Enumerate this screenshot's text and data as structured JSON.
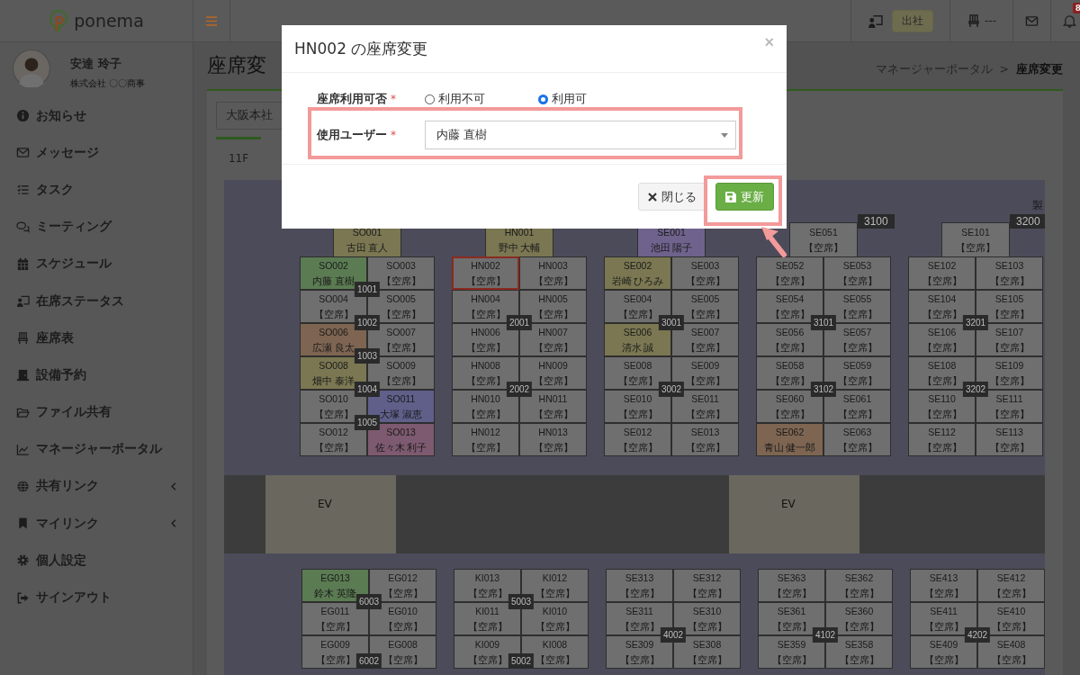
{
  "topbar": {
    "logo": "ponema",
    "status": "出社",
    "seat": "---",
    "notifications": "8"
  },
  "sidebar": {
    "user": {
      "name": "安達 玲子",
      "company": "株式会社 〇〇商事"
    },
    "items": [
      {
        "label": "お知らせ",
        "kind": "link"
      },
      {
        "label": "メッセージ",
        "kind": "link"
      },
      {
        "label": "タスク",
        "kind": "link"
      },
      {
        "label": "ミーティング",
        "kind": "link"
      },
      {
        "label": "スケジュール",
        "kind": "link"
      },
      {
        "label": "在席ステータス",
        "kind": "link"
      },
      {
        "label": "座席表",
        "kind": "link"
      },
      {
        "label": "設備予約",
        "kind": "link"
      },
      {
        "label": "ファイル共有",
        "kind": "link"
      },
      {
        "label": "マネージャーポータル",
        "kind": "link"
      },
      {
        "label": "共有リンク",
        "kind": "group"
      },
      {
        "label": "マイリンク",
        "kind": "group"
      },
      {
        "label": "個人設定",
        "kind": "link"
      },
      {
        "label": "サインアウト",
        "kind": "link"
      }
    ]
  },
  "page": {
    "title": "座席変",
    "breadcrumb": [
      {
        "label": "マネージャーポータル",
        "kind": "link"
      },
      {
        "label": ">",
        "kind": "separator"
      },
      {
        "label": "座席変更",
        "kind": "current"
      }
    ],
    "office": "大阪本社",
    "tabs": [
      {
        "label": "11F",
        "selected": true
      }
    ]
  },
  "seat_map": {
    "corner_label": "製",
    "top_blocks": [
      {
        "head": {
          "id": "SO001",
          "user": "古田 直人",
          "color": "#7a7752",
          "selected": false
        },
        "rows": [
          {
            "seats": [
              {
                "id": "SO002",
                "user": "内藤 直樹",
                "color": "#5b7b52",
                "selected": false
              },
              {
                "id": "SO003",
                "user": "【空席】",
                "selected": false
              }
            ],
            "desk_label": "1001"
          },
          {
            "seats": [
              {
                "id": "SO004",
                "user": "【空席】",
                "selected": false
              },
              {
                "id": "SO005",
                "user": "【空席】",
                "selected": false
              }
            ],
            "desk_label": "1002"
          },
          {
            "seats": [
              {
                "id": "SO006",
                "user": "広瀬 良太",
                "color": "#7d6552",
                "selected": false
              },
              {
                "id": "SO007",
                "user": "【空席】",
                "selected": false
              }
            ],
            "desk_label": "1003"
          },
          {
            "seats": [
              {
                "id": "SO008",
                "user": "畑中 泰洋",
                "color": "#7a7752",
                "selected": false
              },
              {
                "id": "SO009",
                "user": "【空席】",
                "selected": false
              }
            ],
            "desk_label": "1004"
          },
          {
            "seats": [
              {
                "id": "SO010",
                "user": "【空席】",
                "selected": false
              },
              {
                "id": "SO011",
                "user": "大塚 淑恵",
                "color": "#5f5f8a",
                "selected": false
              }
            ],
            "desk_label": "1005"
          },
          {
            "seats": [
              {
                "id": "SO012",
                "user": "【空席】",
                "selected": false
              },
              {
                "id": "SO013",
                "user": "佐々木 利子",
                "color": "#7d5a70",
                "selected": false
              }
            ]
          }
        ]
      },
      {
        "head": {
          "id": "HN001",
          "user": "野中 大輔",
          "color": "#7a7752",
          "selected": false
        },
        "rows": [
          {
            "seats": [
              {
                "id": "HN002",
                "user": "【空席】",
                "selected": true
              },
              {
                "id": "HN003",
                "user": "【空席】",
                "selected": false
              }
            ]
          },
          {
            "seats": [
              {
                "id": "HN004",
                "user": "【空席】",
                "selected": false
              },
              {
                "id": "HN005",
                "user": "【空席】",
                "selected": false
              }
            ],
            "desk_label": "2001"
          },
          {
            "seats": [
              {
                "id": "HN006",
                "user": "【空席】",
                "selected": false
              },
              {
                "id": "HN007",
                "user": "【空席】",
                "selected": false
              }
            ]
          },
          {
            "seats": [
              {
                "id": "HN008",
                "user": "【空席】",
                "selected": false
              },
              {
                "id": "HN009",
                "user": "【空席】",
                "selected": false
              }
            ],
            "desk_label": "2002"
          },
          {
            "seats": [
              {
                "id": "HN010",
                "user": "【空席】",
                "selected": false
              },
              {
                "id": "HN011",
                "user": "【空席】",
                "selected": false
              }
            ]
          },
          {
            "seats": [
              {
                "id": "HN012",
                "user": "【空席】",
                "selected": false
              },
              {
                "id": "HN013",
                "user": "【空席】",
                "selected": false
              }
            ]
          }
        ]
      },
      {
        "head": {
          "id": "SE001",
          "user": "池田 陽子",
          "color": "#6f628c",
          "selected": false
        },
        "rows": [
          {
            "seats": [
              {
                "id": "SE002",
                "user": "岩崎 ひろみ",
                "color": "#7a7752",
                "selected": false
              },
              {
                "id": "SE003",
                "user": "【空席】",
                "selected": false
              }
            ]
          },
          {
            "seats": [
              {
                "id": "SE004",
                "user": "【空席】",
                "selected": false
              },
              {
                "id": "SE005",
                "user": "【空席】",
                "selected": false
              }
            ],
            "desk_label": "3001"
          },
          {
            "seats": [
              {
                "id": "SE006",
                "user": "清水 誠",
                "color": "#7a7752",
                "selected": false
              },
              {
                "id": "SE007",
                "user": "【空席】",
                "selected": false
              }
            ]
          },
          {
            "seats": [
              {
                "id": "SE008",
                "user": "【空席】",
                "selected": false
              },
              {
                "id": "SE009",
                "user": "【空席】",
                "selected": false
              }
            ],
            "desk_label": "3002"
          },
          {
            "seats": [
              {
                "id": "SE010",
                "user": "【空席】",
                "selected": false
              },
              {
                "id": "SE011",
                "user": "【空席】",
                "selected": false
              }
            ]
          },
          {
            "seats": [
              {
                "id": "SE012",
                "user": "【空席】",
                "selected": false
              },
              {
                "id": "SE013",
                "user": "【空席】",
                "selected": false
              }
            ]
          }
        ]
      },
      {
        "head": {
          "id": "SE051",
          "user": "【空席】",
          "selected": false
        },
        "head_label": "3100",
        "rows": [
          {
            "seats": [
              {
                "id": "SE052",
                "user": "【空席】",
                "selected": false
              },
              {
                "id": "SE053",
                "user": "【空席】",
                "selected": false
              }
            ]
          },
          {
            "seats": [
              {
                "id": "SE054",
                "user": "【空席】",
                "selected": false
              },
              {
                "id": "SE055",
                "user": "【空席】",
                "selected": false
              }
            ],
            "desk_label": "3101"
          },
          {
            "seats": [
              {
                "id": "SE056",
                "user": "【空席】",
                "selected": false
              },
              {
                "id": "SE057",
                "user": "【空席】",
                "selected": false
              }
            ]
          },
          {
            "seats": [
              {
                "id": "SE058",
                "user": "【空席】",
                "selected": false
              },
              {
                "id": "SE059",
                "user": "【空席】",
                "selected": false
              }
            ],
            "desk_label": "3102"
          },
          {
            "seats": [
              {
                "id": "SE060",
                "user": "【空席】",
                "selected": false
              },
              {
                "id": "SE061",
                "user": "【空席】",
                "selected": false
              }
            ]
          },
          {
            "seats": [
              {
                "id": "SE062",
                "user": "青山 健一郎",
                "color": "#7d6552",
                "selected": false
              },
              {
                "id": "SE063",
                "user": "【空席】",
                "selected": false
              }
            ]
          }
        ]
      },
      {
        "head": {
          "id": "SE101",
          "user": "【空席】",
          "selected": false
        },
        "head_label": "3200",
        "rows": [
          {
            "seats": [
              {
                "id": "SE102",
                "user": "【空席】",
                "selected": false
              },
              {
                "id": "SE103",
                "user": "【空席】",
                "selected": false
              }
            ]
          },
          {
            "seats": [
              {
                "id": "SE104",
                "user": "【空席】",
                "selected": false
              },
              {
                "id": "SE105",
                "user": "【空席】",
                "selected": false
              }
            ],
            "desk_label": "3201"
          },
          {
            "seats": [
              {
                "id": "SE106",
                "user": "【空席】",
                "selected": false
              },
              {
                "id": "SE107",
                "user": "【空席】",
                "selected": false
              }
            ]
          },
          {
            "seats": [
              {
                "id": "SE108",
                "user": "【空席】",
                "selected": false
              },
              {
                "id": "SE109",
                "user": "【空席】",
                "selected": false
              }
            ],
            "desk_label": "3202"
          },
          {
            "seats": [
              {
                "id": "SE110",
                "user": "【空席】",
                "selected": false
              },
              {
                "id": "SE111",
                "user": "【空席】",
                "selected": false
              }
            ]
          },
          {
            "seats": [
              {
                "id": "SE112",
                "user": "【空席】",
                "selected": false
              },
              {
                "id": "SE113",
                "user": "【空席】",
                "selected": false
              }
            ]
          }
        ]
      }
    ],
    "corridor": {
      "elevators": [
        "EV",
        "EV"
      ]
    },
    "bottom_blocks": [
      {
        "rows": [
          {
            "seats": [
              {
                "id": "EG013",
                "user": "鈴木 英隆",
                "color": "#5b7b52",
                "selected": false
              },
              {
                "id": "EG012",
                "user": "【空席】",
                "selected": false
              }
            ],
            "desk_label": "6003"
          },
          {
            "seats": [
              {
                "id": "EG011",
                "user": "【空席】",
                "selected": false
              },
              {
                "id": "EG010",
                "user": "【空席】",
                "selected": false
              }
            ]
          },
          {
            "seats": [
              {
                "id": "EG009",
                "user": "【空席】",
                "selected": false
              },
              {
                "id": "EG008",
                "user": "【空席】",
                "selected": false
              }
            ],
            "desk_label": "6002"
          }
        ]
      },
      {
        "rows": [
          {
            "seats": [
              {
                "id": "KI013",
                "user": "【空席】",
                "selected": false
              },
              {
                "id": "KI012",
                "user": "【空席】",
                "selected": false
              }
            ],
            "desk_label": "5003"
          },
          {
            "seats": [
              {
                "id": "KI011",
                "user": "【空席】",
                "selected": false
              },
              {
                "id": "KI010",
                "user": "【空席】",
                "selected": false
              }
            ]
          },
          {
            "seats": [
              {
                "id": "KI009",
                "user": "【空席】",
                "selected": false
              },
              {
                "id": "KI008",
                "user": "【空席】",
                "selected": false
              }
            ],
            "desk_label": "5002"
          }
        ]
      },
      {
        "rows": [
          {
            "seats": [
              {
                "id": "SE313",
                "user": "【空席】",
                "selected": false
              },
              {
                "id": "SE312",
                "user": "【空席】",
                "selected": false
              }
            ]
          },
          {
            "seats": [
              {
                "id": "SE311",
                "user": "【空席】",
                "selected": false
              },
              {
                "id": "SE310",
                "user": "【空席】",
                "selected": false
              }
            ],
            "desk_label": "4002"
          },
          {
            "seats": [
              {
                "id": "SE309",
                "user": "【空席】",
                "selected": false
              },
              {
                "id": "SE308",
                "user": "【空席】",
                "selected": false
              }
            ]
          }
        ]
      },
      {
        "rows": [
          {
            "seats": [
              {
                "id": "SE363",
                "user": "【空席】",
                "selected": false
              },
              {
                "id": "SE362",
                "user": "【空席】",
                "selected": false
              }
            ]
          },
          {
            "seats": [
              {
                "id": "SE361",
                "user": "【空席】",
                "selected": false
              },
              {
                "id": "SE360",
                "user": "【空席】",
                "selected": false
              }
            ],
            "desk_label": "4102"
          },
          {
            "seats": [
              {
                "id": "SE359",
                "user": "【空席】",
                "selected": false
              },
              {
                "id": "SE358",
                "user": "【空席】",
                "selected": false
              }
            ]
          }
        ]
      },
      {
        "rows": [
          {
            "seats": [
              {
                "id": "SE413",
                "user": "【空席】",
                "selected": false
              },
              {
                "id": "SE412",
                "user": "【空席】",
                "selected": false
              }
            ]
          },
          {
            "seats": [
              {
                "id": "SE411",
                "user": "【空席】",
                "selected": false
              },
              {
                "id": "SE410",
                "user": "【空席】",
                "selected": false
              }
            ],
            "desk_label": "4202"
          },
          {
            "seats": [
              {
                "id": "SE409",
                "user": "【空席】",
                "selected": false
              },
              {
                "id": "SE408",
                "user": "【空席】",
                "selected": false
              }
            ]
          }
        ]
      }
    ]
  },
  "dialog": {
    "title": "HN002 の座席変更",
    "close": "×",
    "fields": [
      {
        "kind": "radio",
        "label": "座席利用可否",
        "required_mark": "*",
        "options": [
          {
            "label": "利用不可",
            "selected": false
          },
          {
            "label": "利用可",
            "selected": true
          }
        ]
      },
      {
        "kind": "select",
        "label": "使用ユーザー",
        "required_mark": "*",
        "value": "内藤 直樹"
      }
    ],
    "buttons": [
      {
        "label": "閉じる",
        "kind": "close"
      },
      {
        "label": "更新",
        "kind": "save"
      }
    ]
  }
}
